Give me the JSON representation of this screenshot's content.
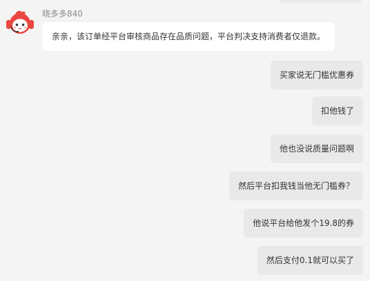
{
  "chat": {
    "incoming": {
      "sender": "晓多多840",
      "avatar_icon": "robot-avatar-icon",
      "text": "亲亲，该订单经平台审核商品存在品质问题，平台判决支持消费者仅退款。"
    },
    "outgoing": [
      "买家说无门槛优惠券",
      "扣他钱了",
      "他也没说质量问题啊",
      "然后平台扣我钱当他无门槛券？",
      "他说平台给他发个19.8的券",
      "然后支付0.1就可以买了"
    ]
  },
  "colors": {
    "background": "#f4f4f4",
    "incoming_bubble": "#ffffff",
    "outgoing_bubble": "#e9e9e9",
    "avatar_red": "#e9473f"
  }
}
